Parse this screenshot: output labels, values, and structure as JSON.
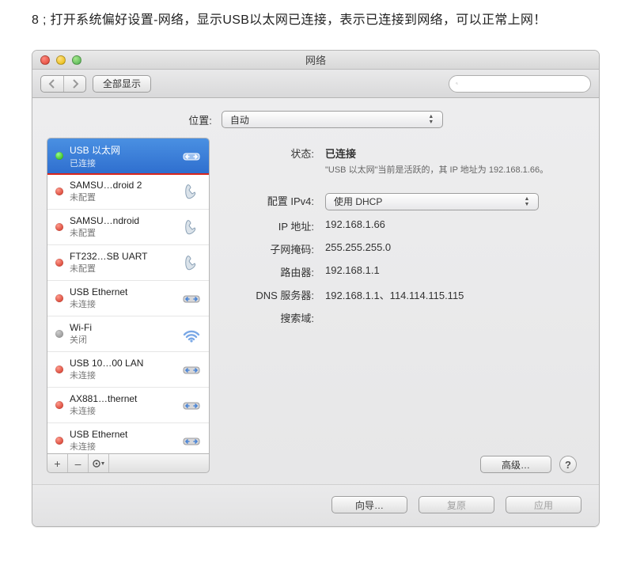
{
  "instruction_text": "8 ; 打开系统偏好设置-网络，显示USB以太网已连接，表示已连接到网络，可以正常上网！",
  "window": {
    "title": "网络",
    "toolbar": {
      "show_all_label": "全部显示",
      "search_placeholder": ""
    },
    "location": {
      "label": "位置:",
      "value": "自动"
    }
  },
  "sidebar": {
    "items": [
      {
        "name": "USB 以太网",
        "status": "已连接",
        "dot": "green",
        "icon": "eth-arrows",
        "selected": true,
        "highlight": true
      },
      {
        "name": "SAMSU…droid 2",
        "status": "未配置",
        "dot": "red",
        "icon": "phone"
      },
      {
        "name": "SAMSU…ndroid",
        "status": "未配置",
        "dot": "red",
        "icon": "phone"
      },
      {
        "name": "FT232…SB UART",
        "status": "未配置",
        "dot": "red",
        "icon": "phone"
      },
      {
        "name": "USB Ethernet",
        "status": "未连接",
        "dot": "red",
        "icon": "eth-arrows"
      },
      {
        "name": "Wi-Fi",
        "status": "关闭",
        "dot": "gray",
        "icon": "wifi"
      },
      {
        "name": "USB 10…00 LAN",
        "status": "未连接",
        "dot": "red",
        "icon": "eth-arrows"
      },
      {
        "name": "AX881…thernet",
        "status": "未连接",
        "dot": "red",
        "icon": "eth-arrows"
      },
      {
        "name": "USB Ethernet",
        "status": "未连接",
        "dot": "red",
        "icon": "eth-arrows"
      }
    ],
    "footer": {
      "add": "+",
      "remove": "–",
      "gear": "✻"
    }
  },
  "detail": {
    "status_label": "状态:",
    "status_value": "已连接",
    "status_desc": "\"USB 以太网\"当前是活跃的，其 IP 地址为 192.168.1.66。",
    "config_label": "配置 IPv4:",
    "config_value": "使用 DHCP",
    "ip_label": "IP 地址:",
    "ip_value": "192.168.1.66",
    "mask_label": "子网掩码:",
    "mask_value": "255.255.255.0",
    "router_label": "路由器:",
    "router_value": "192.168.1.1",
    "dns_label": "DNS 服务器:",
    "dns_value": "192.168.1.1、114.114.115.115",
    "search_label": "搜索域:",
    "search_value": "",
    "advanced_label": "高级…",
    "help_label": "?"
  },
  "buttons": {
    "assistant": "向导…",
    "revert": "复原",
    "apply": "应用"
  },
  "icons": {
    "selected_icon": "eth-arrows-icon"
  }
}
